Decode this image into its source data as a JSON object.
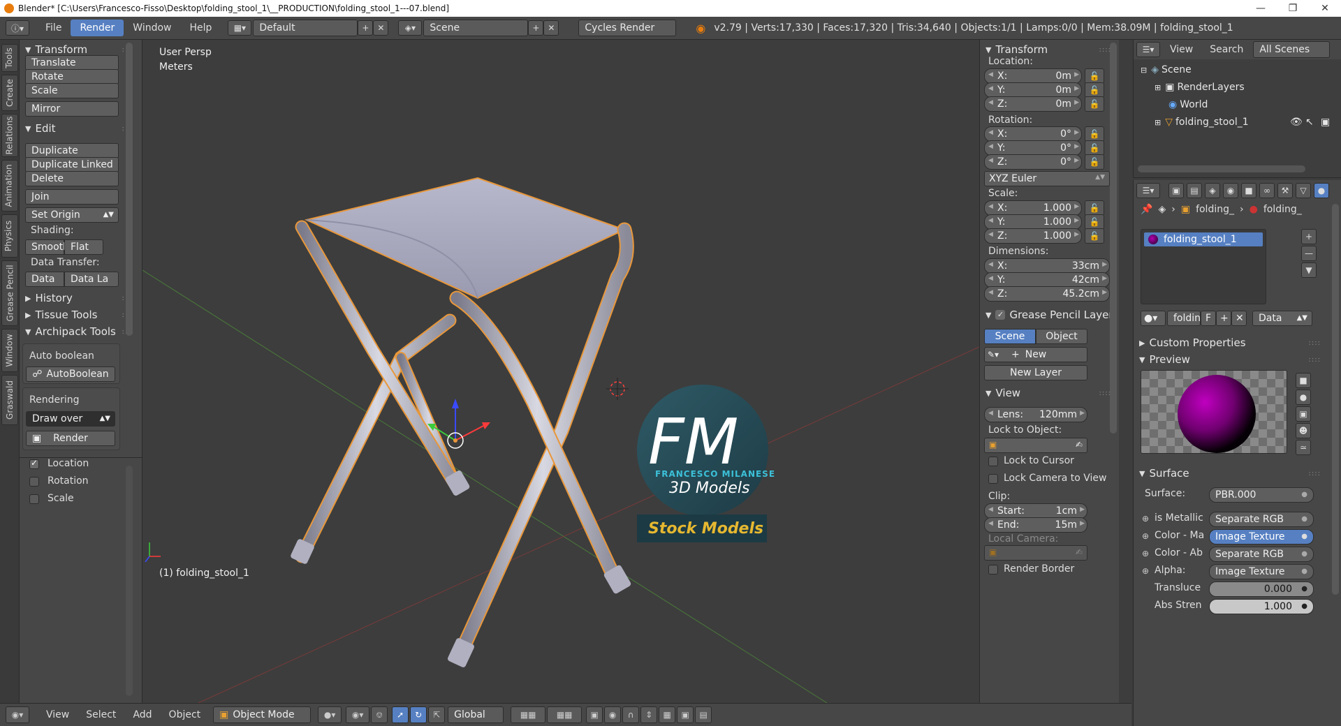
{
  "window": {
    "title": "Blender* [C:\\Users\\Francesco-Fisso\\Desktop\\folding_stool_1\\__PRODUCTION\\folding_stool_1---07.blend]"
  },
  "topbar": {
    "menus": [
      "File",
      "Render",
      "Window",
      "Help"
    ],
    "layout": "Default",
    "scene": "Scene",
    "engine": "Cycles Render",
    "stats": "v2.79 | Verts:17,330 | Faces:17,320 | Tris:34,640 | Objects:1/1 | Lamps:0/0 | Mem:38.09M | folding_stool_1"
  },
  "tool_tabs": [
    "Tools",
    "Create",
    "Relations",
    "Animation",
    "Physics",
    "Grease Pencil",
    "Window",
    "Graswald"
  ],
  "toolshelf": {
    "transform_title": "Transform",
    "transform_buttons": [
      "Translate",
      "Rotate",
      "Scale"
    ],
    "mirror": "Mirror",
    "edit_title": "Edit",
    "edit_buttons": [
      "Duplicate",
      "Duplicate Linked",
      "Delete"
    ],
    "join": "Join",
    "set_origin": "Set Origin",
    "shading_label": "Shading:",
    "smooth": "Smooth",
    "flat": "Flat",
    "data_transfer_label": "Data Transfer:",
    "data": "Data",
    "data_la": "Data La",
    "history": "History",
    "tissue": "Tissue Tools",
    "archipack": "Archipack Tools",
    "auto_boolean_label": "Auto boolean",
    "auto_boolean_btn": "AutoBoolean",
    "rendering_label": "Rendering",
    "draw_over": "Draw over",
    "render_btn": "Render",
    "options": [
      "Location",
      "Rotation",
      "Scale"
    ]
  },
  "viewport": {
    "view_name": "User Persp",
    "units": "Meters",
    "object_label": "(1) folding_stool_1",
    "watermark_letters": "FM",
    "watermark_name": "FRANCESCO MILANESE",
    "watermark_sub": "3D Models",
    "watermark_stock": "Stock Models"
  },
  "npanel": {
    "transform_title": "Transform",
    "location_label": "Location:",
    "location": [
      {
        "axis": "X:",
        "value": "0m"
      },
      {
        "axis": "Y:",
        "value": "0m"
      },
      {
        "axis": "Z:",
        "value": "0m"
      }
    ],
    "rotation_label": "Rotation:",
    "rotation": [
      {
        "axis": "X:",
        "value": "0°"
      },
      {
        "axis": "Y:",
        "value": "0°"
      },
      {
        "axis": "Z:",
        "value": "0°"
      }
    ],
    "rotation_mode": "XYZ Euler",
    "scale_label": "Scale:",
    "scale": [
      {
        "axis": "X:",
        "value": "1.000"
      },
      {
        "axis": "Y:",
        "value": "1.000"
      },
      {
        "axis": "Z:",
        "value": "1.000"
      }
    ],
    "dimensions_label": "Dimensions:",
    "dimensions": [
      {
        "axis": "X:",
        "value": "33cm"
      },
      {
        "axis": "Y:",
        "value": "42cm"
      },
      {
        "axis": "Z:",
        "value": "45.2cm"
      }
    ],
    "grease_title": "Grease Pencil Layer",
    "scene_tab": "Scene",
    "object_tab": "Object",
    "new_btn": "New",
    "new_layer_btn": "New Layer",
    "view_title": "View",
    "lens_label": "Lens:",
    "lens_value": "120mm",
    "lock_object_label": "Lock to Object:",
    "lock_cursor": "Lock to Cursor",
    "lock_camera": "Lock Camera to View",
    "clip_label": "Clip:",
    "clip_start_label": "Start:",
    "clip_start": "1cm",
    "clip_end_label": "End:",
    "clip_end": "15m",
    "local_camera": "Local Camera:",
    "render_border": "Render Border"
  },
  "outliner": {
    "menus": [
      "View",
      "Search"
    ],
    "filter": "All Scenes",
    "items": [
      "Scene",
      "RenderLayers",
      "World",
      "folding_stool_1"
    ]
  },
  "properties": {
    "breadcrumb": [
      "folding_",
      "folding_"
    ],
    "material_slot": "folding_stool_1",
    "mat_name": "foldin",
    "mat_f": "F",
    "data_select": "Data",
    "custom_props": "Custom Properties",
    "preview": "Preview",
    "surface_title": "Surface",
    "surface_label": "Surface:",
    "surface_value": "PBR.000",
    "inputs": [
      {
        "label": "is Metallic",
        "value": "Separate RGB"
      },
      {
        "label": "Color - Ma",
        "value": "Image Texture"
      },
      {
        "label": "Color - Ab",
        "value": "Separate RGB"
      },
      {
        "label": "Alpha:",
        "value": "Image Texture"
      }
    ],
    "translucency_label": "Transluce",
    "translucency_value": "0.000",
    "translucency_fill": 0.0,
    "abs_label": "Abs Stren",
    "abs_value": "1.000",
    "abs_fill": 1.0
  },
  "statusbar": {
    "menus": [
      "View",
      "Select",
      "Add",
      "Object"
    ],
    "mode": "Object Mode",
    "orientation": "Global"
  },
  "colors": {
    "accent": "#5680c2",
    "selection_outline": "#e8973a",
    "material_purple": "#8a1a8a",
    "stock_gold": "#e6b830"
  }
}
